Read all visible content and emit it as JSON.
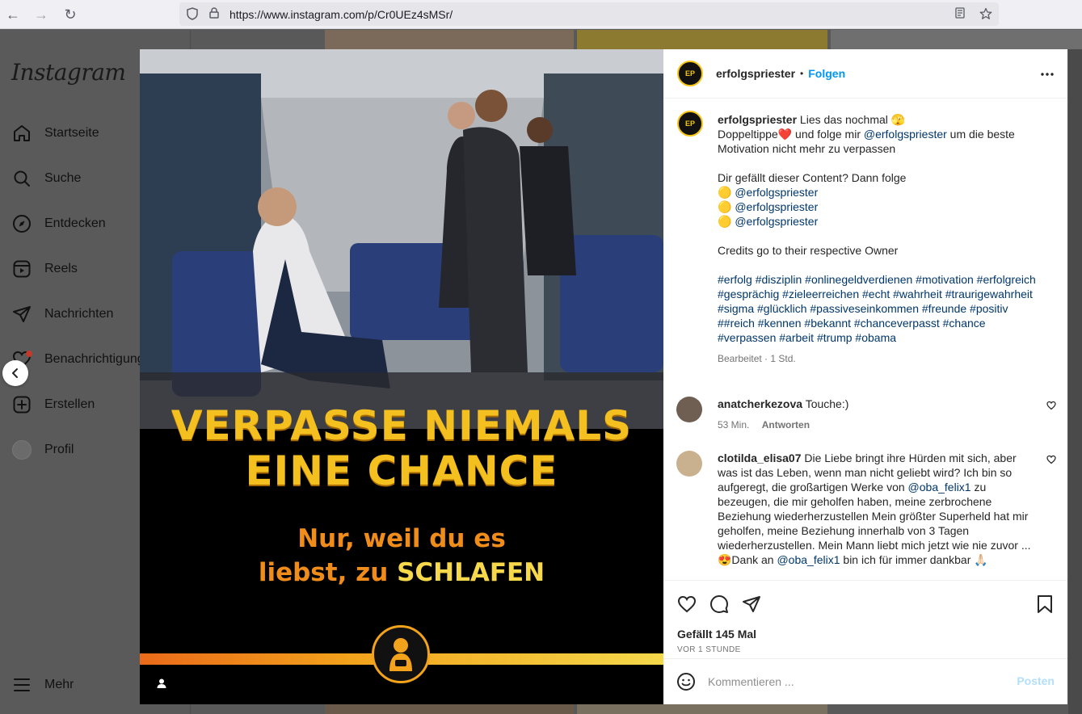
{
  "browser": {
    "url": "https://www.instagram.com/p/Cr0UEz4sMSr/"
  },
  "sidebar": {
    "logo": "Instagram",
    "items": [
      {
        "label": "Startseite",
        "icon": "home-icon"
      },
      {
        "label": "Suche",
        "icon": "search-icon"
      },
      {
        "label": "Entdecken",
        "icon": "compass-icon"
      },
      {
        "label": "Reels",
        "icon": "reels-icon"
      },
      {
        "label": "Nachrichten",
        "icon": "send-icon"
      },
      {
        "label": "Benachrichtigungen",
        "icon": "heart-icon"
      },
      {
        "label": "Erstellen",
        "icon": "plus-icon"
      },
      {
        "label": "Profil",
        "icon": "profile-icon"
      }
    ],
    "more_label": "Mehr"
  },
  "post_image": {
    "headline_line1": "VERPASSE NIEMALS",
    "headline_line2": "EINE CHANCE",
    "sub_line1": "Nur, weil du es",
    "sub_line2_prefix": "liebst, zu ",
    "sub_line2_highlight": "SCHLAFEN"
  },
  "post": {
    "avatar_text": "EP",
    "username": "erfolgspriester",
    "dot": "•",
    "follow_label": "Folgen",
    "caption": {
      "username": "erfolgspriester",
      "line1": " Lies das nochmal 🫣",
      "line2_a": "Doppeltippe❤️ und folge mir ",
      "line2_mention": "@erfolgspriester",
      "line2_b": " um die beste Motivation nicht mehr zu verpassen",
      "line3": "Dir gefällt dieser Content? Dann folge",
      "mention_lines": [
        "🟡 @erfolgspriester",
        "🟡 @erfolgspriester",
        "🟡 @erfolgspriester"
      ],
      "credits": "Credits go to their respective Owner",
      "hashtags": "#erfolg #disziplin #onlinegeldverdienen #motivation #erfolgreich #gesprächig #zieleerreichen #echt #wahrheit #traurigewahrheit #sigma #glücklich #passiveseinkommen #freunde #positiv ##reich #kennen #bekannt #chanceverpasst #chance #verpassen #arbeit #trump #obama",
      "meta": "Bearbeitet · 1 Std."
    },
    "comments": [
      {
        "username": "anatcherkezova",
        "text": " Touche:)",
        "time": "53 Min.",
        "reply_label": "Antworten"
      },
      {
        "username": "clotilda_elisa07",
        "text_a": " Die Liebe bringt ihre Hürden mit sich, aber was ist das Leben, wenn man nicht geliebt wird? Ich bin so aufgeregt, die großartigen Werke von ",
        "mention": "@oba_felix1",
        "text_b": " zu bezeugen, die mir geholfen haben, meine zerbrochene Beziehung wiederherzustellen Mein größter Superheld hat mir geholfen, meine Beziehung innerhalb von 3 Tagen wiederherzustellen. Mein Mann liebt mich jetzt wie nie zuvor ... 😍Dank an ",
        "mention2": "@oba_felix1",
        "text_c": " bin ich für immer dankbar 🙏🏻"
      }
    ],
    "likes": "Gefällt 145 Mal",
    "time_ago": "VOR 1 STUNDE",
    "comment_placeholder": "Kommentieren ...",
    "post_label": "Posten"
  }
}
